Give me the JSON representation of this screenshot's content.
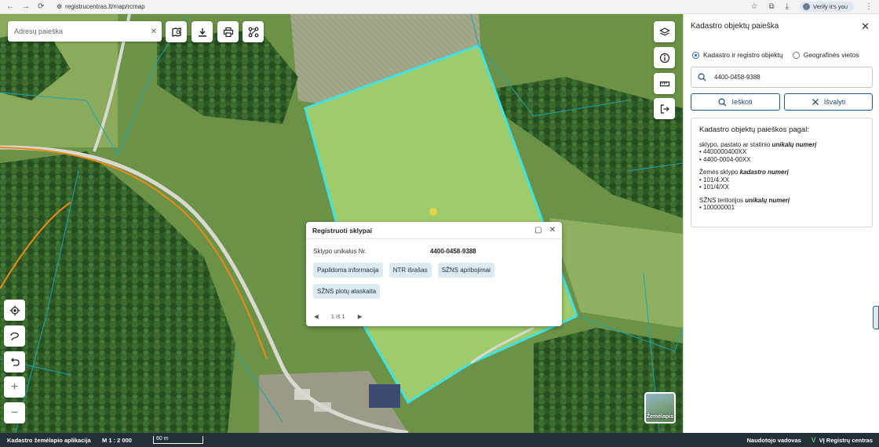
{
  "browser": {
    "url": "registrucentras.lt/map/rcmap",
    "verify_label": "Verify it's you",
    "back_glyph": "←",
    "forward_glyph": "→",
    "reload_glyph": "⟳",
    "site_glyph": "⚙",
    "star_glyph": "☆",
    "ext_glyph": "⧉",
    "download_glyph": "⤓",
    "menu_glyph": "⋮"
  },
  "map": {
    "search_placeholder": "Adresų paieška",
    "clear_glyph": "✕",
    "top_tools": [
      {
        "name": "map-book-icon"
      },
      {
        "name": "download-icon"
      },
      {
        "name": "print-icon"
      },
      {
        "name": "route-icon"
      }
    ],
    "right_tools": [
      {
        "name": "layers-icon"
      },
      {
        "name": "info-icon"
      },
      {
        "name": "ruler-icon"
      },
      {
        "name": "exit-icon"
      }
    ],
    "left_tools": [
      {
        "name": "locate-icon"
      },
      {
        "name": "lasso-icon"
      },
      {
        "name": "undo-icon"
      },
      {
        "name": "zoom-in-icon",
        "glyph": "+"
      },
      {
        "name": "zoom-out-icon",
        "glyph": "−"
      }
    ],
    "basemap_label": "Žemėlapis"
  },
  "popup": {
    "title": "Registruoti sklypai",
    "maximize_glyph": "▢",
    "close_glyph": "✕",
    "field_label": "Sklypo unikalus Nr.",
    "field_value": "4400-0458-9388",
    "chips": [
      "Papildoma informacija",
      "NTR išrašas",
      "SŽNS apribojimai",
      "SŽNS plotų ataskaita"
    ],
    "pager_prev": "◀",
    "pager_text": "1 iš 1",
    "pager_next": "▶"
  },
  "status": {
    "app_name": "Kadastro žemėlapio aplikacija",
    "scale": "M 1 : 2 000",
    "scalebar": "60 m",
    "guide": "Naudotojo vadovas",
    "org": "VĮ Registrų centras",
    "org_logo": "V"
  },
  "panel": {
    "title": "Kadastro objektų paieška",
    "close_glyph": "✕",
    "radio1": "Kadastro ir registro objektų",
    "radio2": "Geografinės vietos",
    "input_value": "4400-0458-9388",
    "search_btn": "Ieškoti",
    "clear_btn": "Išvalyti",
    "info_heading": "Kadastro objektų paieškos pagal:",
    "g1_label": "sklypo, pastato ar statinio ",
    "g1_em": "unikalų numerį",
    "g1_items": [
      "• 4400000400XX",
      "• 4400-0004-00XX"
    ],
    "g2_label": "Žemės sklypo ",
    "g2_em": "kadastro numerį",
    "g2_items": [
      "• 101/4:XX",
      "• 101/4/XX"
    ],
    "g3_label": "SŽNS teritorijos ",
    "g3_em": "unikalų numerį",
    "g3_items": [
      "• 100000001"
    ]
  },
  "colors": {
    "parcel_highlight": "#3fe3e3",
    "parcel_lines": "#1aa6b0",
    "road_orange": "#e88a1a",
    "accent": "#1f5d8f"
  }
}
